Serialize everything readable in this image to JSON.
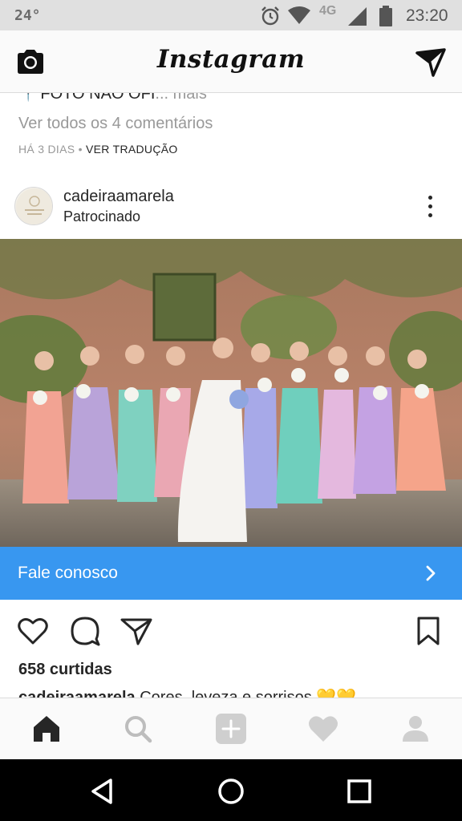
{
  "status_bar": {
    "temperature": "24°",
    "network": "4G",
    "time": "23:20"
  },
  "header": {
    "logo": "Instagram",
    "left_icon": "camera-icon",
    "right_icon": "direct-message-icon"
  },
  "previous_post": {
    "caption_cut": "FOTO NAO OFI",
    "caption_more": "... mais",
    "view_comments": "Ver todos os 4 comentários",
    "time_ago": "HÁ 3 DIAS",
    "separator": " • ",
    "translate": "VER TRADUÇÃO"
  },
  "post": {
    "username": "cadeiraamarela",
    "sponsored": "Patrocinado",
    "cta_label": "Fale conosco",
    "likes": "658 curtidas",
    "caption_user": "cadeiraamarela",
    "caption_text": " Cores, leveza e sorrisos 💛💛"
  },
  "colors": {
    "accent": "#3897f0",
    "text": "#262626",
    "muted": "#999999",
    "status_bar": "#e0e0e0"
  },
  "bottom_nav": [
    "home-icon",
    "search-icon",
    "add-post-icon",
    "activity-heart-icon",
    "profile-icon"
  ],
  "system_nav": [
    "back-icon",
    "home-circle-icon",
    "recents-icon"
  ]
}
